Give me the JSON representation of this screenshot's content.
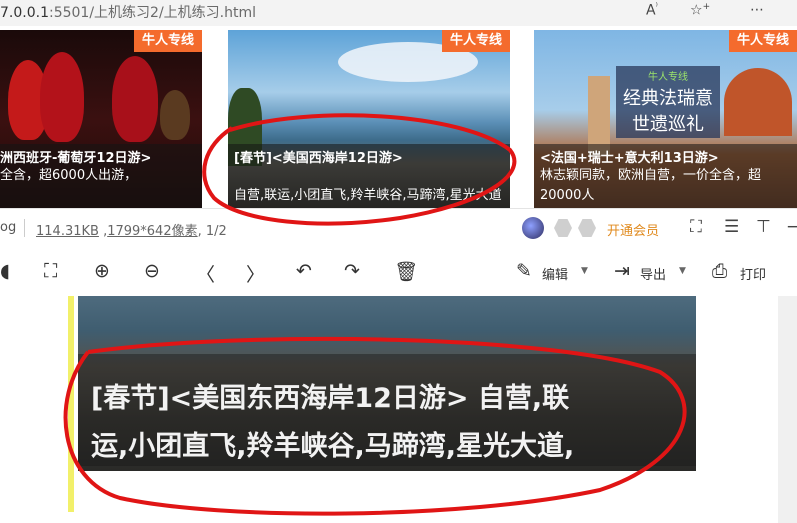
{
  "browser": {
    "url_prefix": "7.0.0.1",
    "url_path": ":5501/上机练习2/上机练习.html",
    "icons": [
      "read-aloud-icon",
      "add-favorite-icon",
      "menu-dots-icon"
    ]
  },
  "cards": [
    {
      "badge": "牛人专线",
      "title": "洲西班牙-葡萄牙12日游>",
      "desc": "全含，超6000人出游，"
    },
    {
      "badge": "牛人专线",
      "title": "[春节]<美国西海岸12日游>",
      "desc": "自营,联运,小团直飞,羚羊峡谷,马蹄湾,星光大道"
    },
    {
      "badge": "牛人专线",
      "title": "<法国+瑞士+意大利13日游>",
      "desc": "林志颖同款，欧洲自营，一价全含，超20000人",
      "image_text": [
        "经典法瑞意",
        "世遗巡礼"
      ],
      "logo_text": "牛人专线"
    }
  ],
  "viewer": {
    "ext": "og",
    "filesize": "114.31KB",
    "dimensions": "1799*642像素",
    "page": ", 1/2",
    "vip": "开通会员",
    "toolbar": {
      "edit": "编辑",
      "export": "导出",
      "print": "打印"
    }
  },
  "preview": {
    "line1": "[春节]<美国东西海岸12日游> 自营,联",
    "line2": "运,小团直飞,羚羊峡谷,马蹄湾,星光大道,"
  },
  "colors": {
    "badge": "#f46b2d",
    "vip": "#e08a1e",
    "annotation": "#e01515"
  }
}
